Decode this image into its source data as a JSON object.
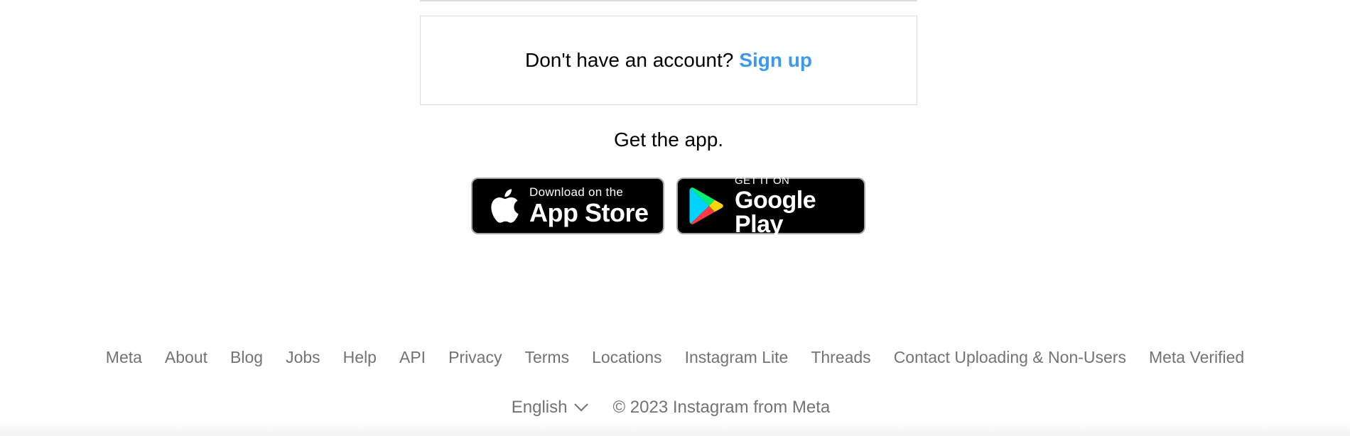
{
  "signup": {
    "prompt": "Don't have an account?",
    "link": "Sign up"
  },
  "get_app": {
    "heading": "Get the app.",
    "app_store": {
      "small": "Download on the",
      "big": "App Store"
    },
    "google_play": {
      "small": "GET IT ON",
      "big": "Google Play"
    }
  },
  "footer": {
    "links": [
      "Meta",
      "About",
      "Blog",
      "Jobs",
      "Help",
      "API",
      "Privacy",
      "Terms",
      "Locations",
      "Instagram Lite",
      "Threads",
      "Contact Uploading & Non-Users",
      "Meta Verified"
    ],
    "language": "English",
    "copyright": "© 2023 Instagram from Meta"
  },
  "colors": {
    "link_blue": "#3b9aee",
    "muted_text": "#737373",
    "border": "#dbdbdb"
  }
}
